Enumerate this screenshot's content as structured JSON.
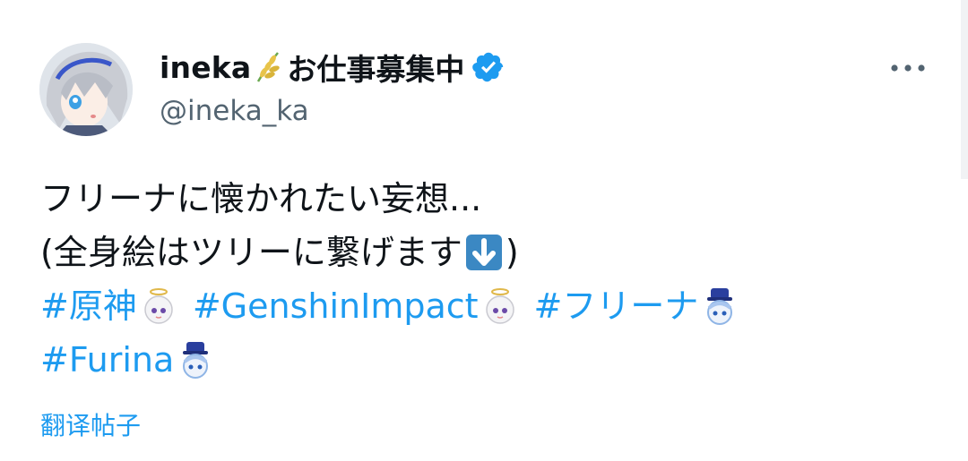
{
  "author": {
    "display_name": "ineka",
    "name_emoji": "rice-plant-emoji",
    "name_suffix": "お仕事募集中",
    "verified": true,
    "handle": "@ineka_ka"
  },
  "tweet": {
    "line1": "フリーナに懐かれたい妄想...",
    "line2_before": "(全身絵はツリーに繋げます",
    "line2_emoji": "down-arrow-emoji",
    "line2_after": ")",
    "hashtags": [
      "#原神",
      "#GenshinImpact",
      "#フリーナ",
      "#Furina"
    ]
  },
  "translate_label": "翻译帖子",
  "colors": {
    "link": "#1d9bf0",
    "text": "#0f1419",
    "secondary": "#536471",
    "verified": "#1d9bf0"
  },
  "icons": {
    "more": "more-options-icon",
    "verified": "verified-badge-icon"
  }
}
